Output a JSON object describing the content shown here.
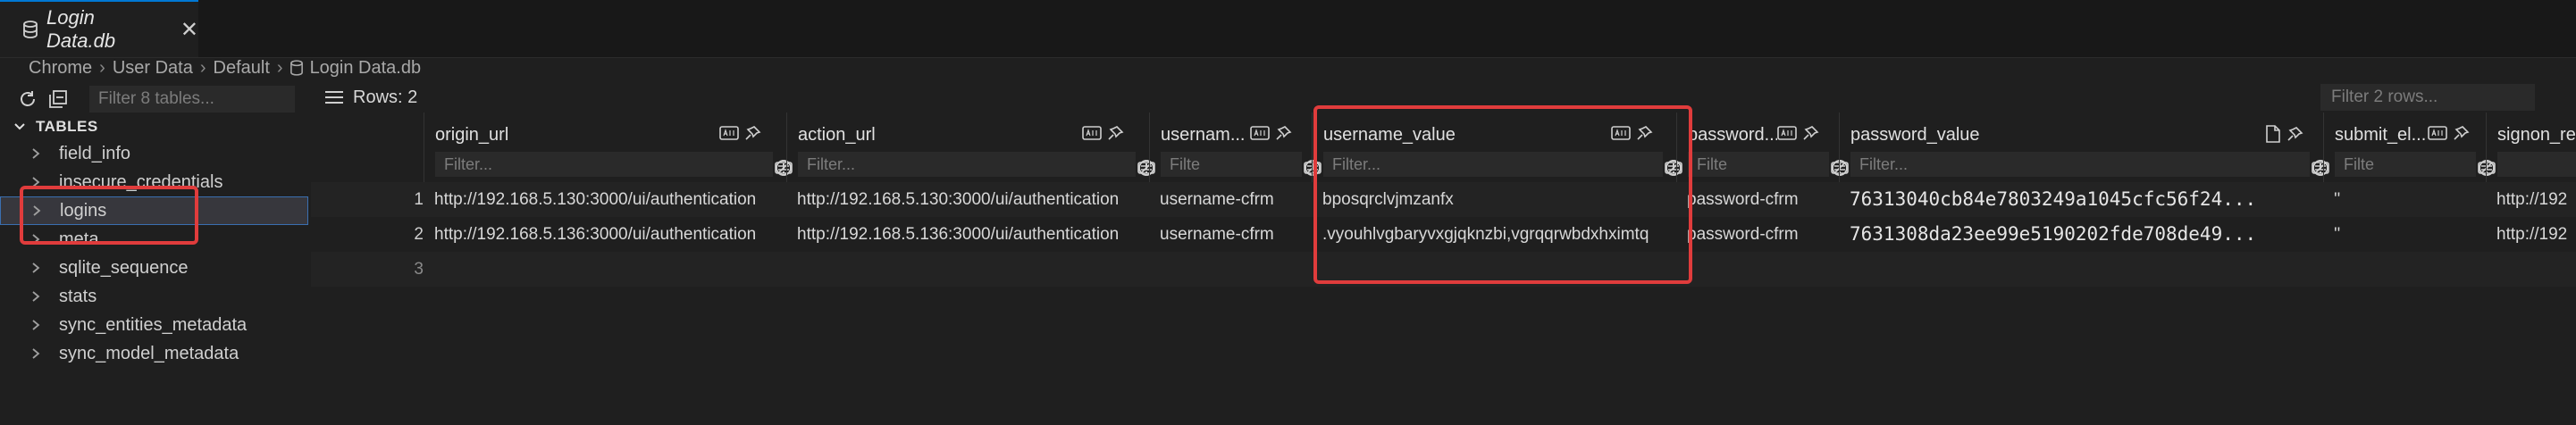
{
  "tab": {
    "label": "Login Data.db",
    "close": "✕"
  },
  "breadcrumb": [
    "Chrome",
    "User Data",
    "Default",
    "Login Data.db"
  ],
  "sidebar": {
    "filter_placeholder": "Filter 8 tables...",
    "section": "TABLES",
    "tables": [
      "field_info",
      "insecure_credentials",
      "logins",
      "meta",
      "sqlite_sequence",
      "stats",
      "sync_entities_metadata",
      "sync_model_metadata"
    ],
    "selected": "logins"
  },
  "main": {
    "rows_label": "Rows: 2",
    "filter_rows_placeholder": "Filter 2 rows...",
    "columns": [
      {
        "title": "origin_url",
        "filter": "Filter..."
      },
      {
        "title": "action_url",
        "filter": "Filter..."
      },
      {
        "title": "usernam...",
        "filter": "Filte"
      },
      {
        "title": "username_value",
        "filter": "Filter..."
      },
      {
        "title": "password...",
        "filter": "Filte"
      },
      {
        "title": "password_value",
        "filter": "Filter..."
      },
      {
        "title": "submit_el...",
        "filter": "Filte"
      },
      {
        "title": "signon_rea",
        "filter": ""
      }
    ],
    "rows": [
      {
        "num": "1",
        "origin_url": "http://192.168.5.130:3000/ui/authentication",
        "action_url": "http://192.168.5.130:3000/ui/authentication",
        "username_element": "username-cfrm",
        "username_value": "bposqrclvjmzanfx",
        "password_element": "password-cfrm",
        "password_value": "76313040cb84e7803249a1045cfc56f24...",
        "submit_element": "''",
        "signon_realm": "http://192"
      },
      {
        "num": "2",
        "origin_url": "http://192.168.5.136:3000/ui/authentication",
        "action_url": "http://192.168.5.136:3000/ui/authentication",
        "username_element": "username-cfrm",
        "username_value": ".vyouhlvgbaryvxgjqknzbi,vgrqqrwbdxhximtq",
        "password_element": "password-cfrm",
        "password_value": "7631308da23ee99e5190202fde708de49...",
        "submit_element": "''",
        "signon_realm": "http://192"
      }
    ],
    "empty_row_num": "3"
  },
  "colors": {
    "accent": "#0078d4",
    "highlight": "#e03c3c",
    "background": "#1f1f1f"
  }
}
